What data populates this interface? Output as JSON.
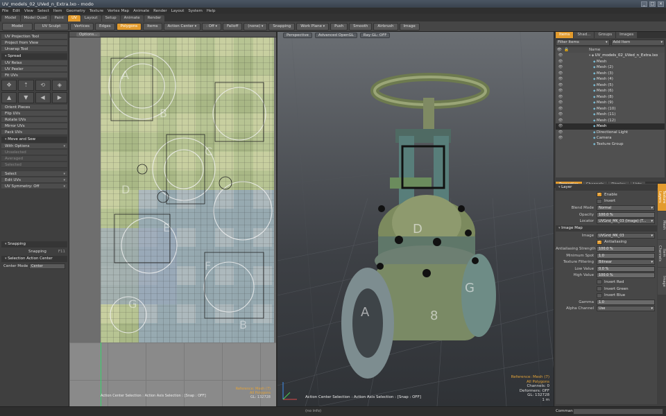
{
  "window": {
    "title": "UV_models_02_UVed_n_Extra.lxo - modo",
    "min": "_",
    "max": "□",
    "close": "×"
  },
  "menu": [
    "File",
    "Edit",
    "View",
    "Select",
    "Item",
    "Geometry",
    "Texture",
    "Vertex Map",
    "Animate",
    "Render",
    "Layout",
    "System",
    "Help"
  ],
  "layout_tabs": [
    {
      "label": "Model",
      "active": false
    },
    {
      "label": "Model Quad",
      "active": false
    },
    {
      "label": "Paint",
      "active": false
    },
    {
      "label": "UV",
      "active": true
    },
    {
      "label": "Layout",
      "active": false
    },
    {
      "label": "Setup",
      "active": false
    },
    {
      "label": "Animate",
      "active": false
    },
    {
      "label": "Render",
      "active": false
    }
  ],
  "toolbar": {
    "model": "Model",
    "uv_sculpt": "UV Sculpt",
    "vertices": "Vertices",
    "edges": "Edges",
    "polygons": "Polygons",
    "items": "Items",
    "action_center": "Action Center",
    "off": ": Off",
    "falloff": "Falloff",
    "none": "(none)",
    "snapping": "Snapping",
    "work_plane": "Work Plane",
    "push": "Push",
    "smooth": "Smooth",
    "airbrush": "Airbrush",
    "image": "Image"
  },
  "left_panel": {
    "tools": [
      "UV Projection Tool",
      "Project from View",
      "Unwrap Tool"
    ],
    "spread_header": "Spread",
    "relax": [
      "UV Relax",
      "UV Peeler",
      "Fit UVs"
    ],
    "ops": [
      "Orient Pieces",
      "Flip UVs",
      "Rotate UVs",
      "Mirror UVs",
      "Pack UVs"
    ],
    "move_sew_header": "Move and Sew",
    "with_options": "With Options",
    "dim": [
      "Unselected",
      "Averaged",
      "Selected"
    ],
    "select": "Select",
    "edit_uvs": "Edit UVs",
    "uv_symmetry": "UV Symmetry: Off",
    "snapping_header": "Snapping",
    "snapping_label": "Snapping",
    "snapping_key": "F11",
    "sel_action_header": "Selection Action Center",
    "center_mode_label": "Center Mode",
    "center_mode_value": "Center"
  },
  "uv_view": {
    "options": "Options...",
    "status": "Action Center Selection : Action Axis Selection : [Snap : OFF]",
    "ref": "Reference: Mesh (7)",
    "polys": "All Polygons",
    "gl": "GL: 132728"
  },
  "viewport": {
    "perspective": "Perspective",
    "advanced_opengl": "Advanced OpenGL",
    "ray_gl": "Ray GL: OFF",
    "status": "Action Center Selection : Action Axis Selection : [Snap : OFF]",
    "ref": "Reference: Mesh (7)",
    "polys": "All Polygons",
    "channels": "Channels: 0",
    "deformers": "Deformers: OFF",
    "gl": "GL: 132728",
    "unit": "1 m"
  },
  "items_panel": {
    "tabs": [
      {
        "label": "Items",
        "active": true
      },
      {
        "label": "Shad...",
        "active": false
      },
      {
        "label": "Groups",
        "active": false
      },
      {
        "label": "Images",
        "active": false
      }
    ],
    "filter": "Filter Items",
    "add": "Add Item",
    "name_col": "Name",
    "rows": [
      {
        "name": "UV_models_02_UVed_n_Extra.lxo",
        "root": true,
        "sel": false
      },
      {
        "name": "Mesh",
        "sel": false
      },
      {
        "name": "Mesh (2)",
        "sel": false
      },
      {
        "name": "Mesh (3)",
        "sel": false
      },
      {
        "name": "Mesh (4)",
        "sel": false
      },
      {
        "name": "Mesh (5)",
        "sel": false
      },
      {
        "name": "Mesh (6)",
        "sel": false
      },
      {
        "name": "Mesh (8)",
        "sel": false
      },
      {
        "name": "Mesh (9)",
        "sel": false
      },
      {
        "name": "Mesh (10)",
        "sel": false
      },
      {
        "name": "Mesh (11)",
        "sel": false
      },
      {
        "name": "Mesh (12)",
        "sel": false
      },
      {
        "name": "Mesh",
        "sel": true
      },
      {
        "name": "Directional Light",
        "sel": false
      },
      {
        "name": "Camera",
        "sel": false
      },
      {
        "name": "Texture Group",
        "sel": false
      }
    ]
  },
  "properties": {
    "tabs": [
      {
        "label": "Properties",
        "active": true
      },
      {
        "label": "Channels",
        "active": false
      },
      {
        "label": "Display",
        "active": false
      },
      {
        "label": "Lists",
        "active": false
      }
    ],
    "side_tabs": [
      "Texture Layers",
      "Mesh",
      "Item Channels",
      "Image"
    ],
    "layer_header": "Layer",
    "enable": "Enable",
    "invert": "Invert",
    "blend_label": "Blend Mode",
    "blend_value": "Normal",
    "opacity_label": "Opacity",
    "opacity_value": "100.0 %",
    "locator_label": "Locator",
    "locator_value": "UVGrid_MK_03 (Image) (T...",
    "image_map_header": "Image Map",
    "image_label": "Image",
    "image_value": "UVGrid_MK_03",
    "antialiasing": "Antialiasing",
    "aa_strength_label": "Antialiasing Strength",
    "aa_strength_value": "100.0 %",
    "min_spot_label": "Minimum Spot",
    "min_spot_value": "1.0",
    "tex_filter_label": "Texture Filtering",
    "tex_filter_value": "Bilinear",
    "low_label": "Low Value",
    "low_value": "0.0 %",
    "high_label": "High Value",
    "high_value": "100.0 %",
    "invert_red": "Invert Red",
    "invert_green": "Invert Green",
    "invert_blue": "Invert Blue",
    "gamma_label": "Gamma",
    "gamma_value": "1.0",
    "alpha_label": "Alpha Channel",
    "alpha_value": "Use"
  },
  "status": {
    "no_info": "(no info)",
    "command": "Command"
  }
}
